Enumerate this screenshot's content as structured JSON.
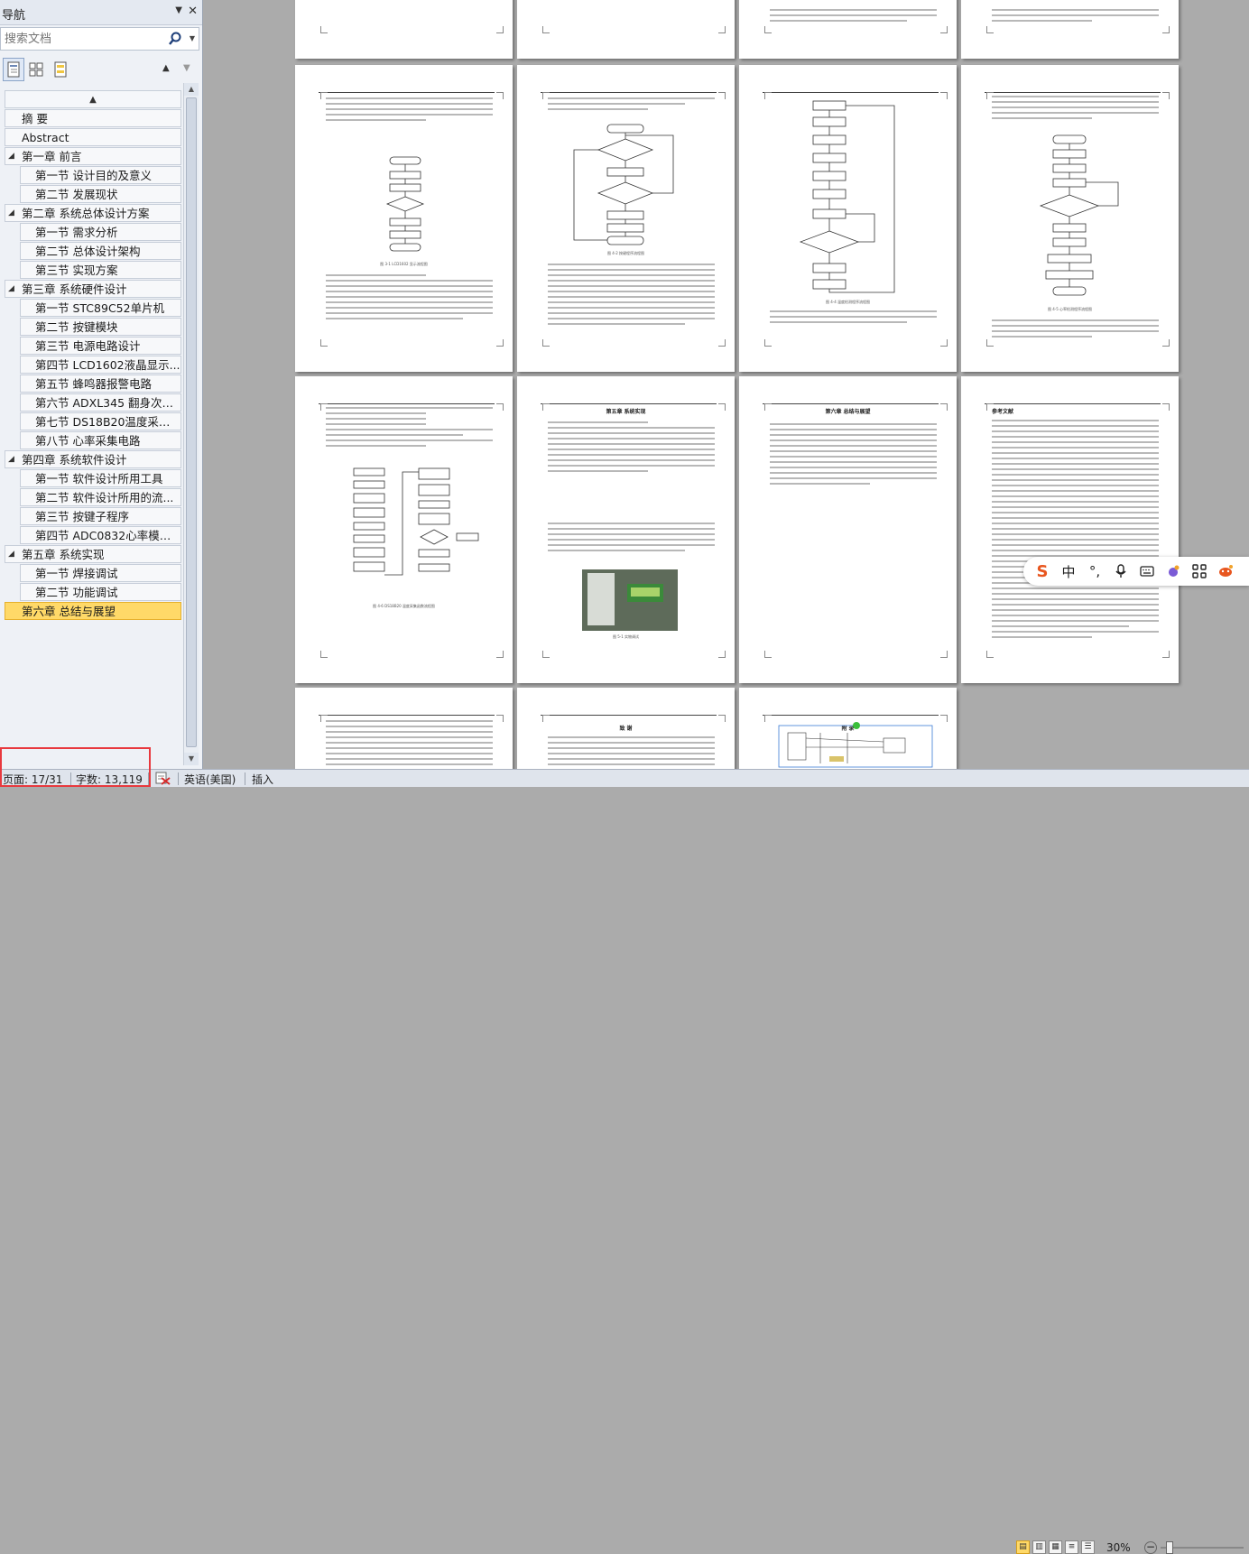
{
  "nav": {
    "title": "导航",
    "search_placeholder": "搜索文档",
    "tree": [
      {
        "label": "摘  要",
        "level": 0,
        "expand": ""
      },
      {
        "label": "Abstract",
        "level": 0,
        "expand": ""
      },
      {
        "label": "第一章 前言",
        "level": 0,
        "expand": "◢"
      },
      {
        "label": "第一节  设计目的及意义",
        "level": 1
      },
      {
        "label": "第二节    发展现状",
        "level": 1
      },
      {
        "label": "第二章 系统总体设计方案",
        "level": 0,
        "expand": "◢"
      },
      {
        "label": "第一节 需求分析",
        "level": 1
      },
      {
        "label": "第二节 总体设计架构",
        "level": 1
      },
      {
        "label": "第三节 实现方案",
        "level": 1
      },
      {
        "label": "第三章 系统硬件设计",
        "level": 0,
        "expand": "◢"
      },
      {
        "label": "第一节 STC89C52单片机",
        "level": 1
      },
      {
        "label": "第二节 按键模块",
        "level": 1
      },
      {
        "label": "第三节 电源电路设计",
        "level": 1
      },
      {
        "label": "第四节 LCD1602液晶显示...",
        "level": 1
      },
      {
        "label": "第五节 蜂鸣器报警电路",
        "level": 1
      },
      {
        "label": "第六节 ADXL345 翻身次数...",
        "level": 1
      },
      {
        "label": "第七节 DS18B20温度采集...",
        "level": 1
      },
      {
        "label": "第八节 心率采集电路",
        "level": 1
      },
      {
        "label": "第四章 系统软件设计",
        "level": 0,
        "expand": "◢"
      },
      {
        "label": "第一节 软件设计所用工具",
        "level": 1
      },
      {
        "label": "第二节 软件设计所用的流...",
        "level": 1
      },
      {
        "label": "第三节 按键子程序",
        "level": 1
      },
      {
        "label": "第四节 ADC0832心率模数...",
        "level": 1
      },
      {
        "label": "第五章 系统实现",
        "level": 0,
        "expand": "◢"
      },
      {
        "label": "第一节 焊接调试",
        "level": 1
      },
      {
        "label": "第二节 功能调试",
        "level": 1
      },
      {
        "label": "第六章 总结与展望",
        "level": 0,
        "expand": "",
        "selected": true
      }
    ]
  },
  "pages": {
    "row1": [
      {
        "caption": "图 3-1 LCD1602 显示流程图",
        "title": ""
      },
      {
        "caption": "图 4-2 按键程序流程图",
        "title": ""
      },
      {
        "caption": "图 4-4 温度检测程序流程图",
        "title": ""
      },
      {
        "caption": "图 4-5 心率检测程序流程图",
        "title": ""
      }
    ],
    "row2": [
      {
        "caption": "图 4-6 DS18B20 温度采集函数流程图",
        "title": ""
      },
      {
        "caption": "图 5-1 实物调试",
        "title": "第五章  系统实现"
      },
      {
        "caption": "",
        "title": "第六章  总结与展望"
      },
      {
        "caption": "",
        "title": "参考文献"
      }
    ],
    "row3": [
      {
        "title": ""
      },
      {
        "title": "致  谢"
      },
      {
        "title": "附  录"
      }
    ]
  },
  "status": {
    "page": "页面: 17/31",
    "words": "字数: 13,119",
    "language": "英语(美国)",
    "mode": "插入",
    "zoom": "30%"
  },
  "ime": {
    "logo": "S",
    "lang": "中",
    "punct": "°,"
  },
  "colors": {
    "selected_item": "#ffd968",
    "highlight_box": "#e8393e"
  }
}
